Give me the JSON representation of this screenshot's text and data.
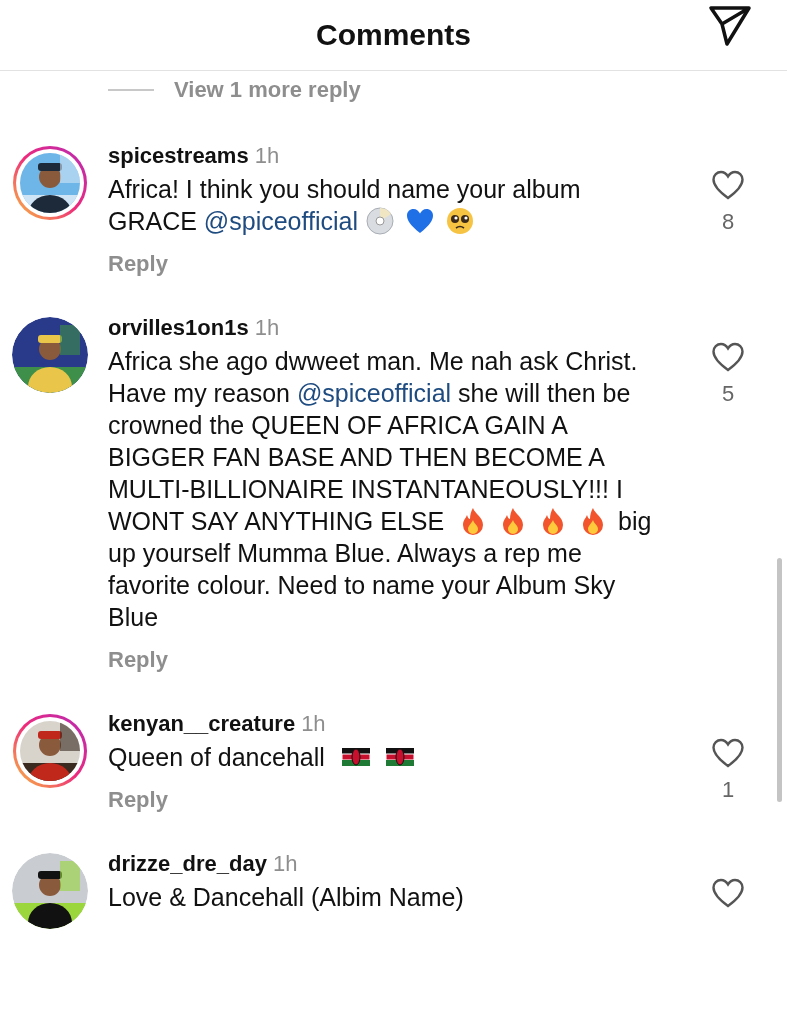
{
  "header": {
    "title": "Comments"
  },
  "view_more": "View 1 more reply",
  "comments": [
    {
      "username": "spicestreams",
      "time": "1h",
      "story_ring": true,
      "likes": "8",
      "reply": "Reply",
      "body": [
        {
          "kind": "text",
          "text": "Africa! I think you should name your album GRACE "
        },
        {
          "kind": "mention",
          "text": "@spiceofficial"
        },
        {
          "kind": "cd"
        },
        {
          "kind": "blue-heart"
        },
        {
          "kind": "pleading"
        }
      ]
    },
    {
      "username": "orvilles1on1s",
      "time": "1h",
      "story_ring": false,
      "likes": "5",
      "reply": "Reply",
      "body": [
        {
          "kind": "text",
          "text": "Africa she ago dwweet man. Me nah ask Christ. Have my reason "
        },
        {
          "kind": "mention",
          "text": "@spiceofficial"
        },
        {
          "kind": "text",
          "text": " she will then be crowned the QUEEN OF AFRICA GAIN A BIGGER FAN BASE AND THEN BECOME A MULTI-BILLIONAIRE INSTANTANEOUSLY!!! I WONT SAY ANYTHING ELSE "
        },
        {
          "kind": "fire"
        },
        {
          "kind": "fire"
        },
        {
          "kind": "fire"
        },
        {
          "kind": "fire"
        },
        {
          "kind": "text",
          "text": " big up yourself Mumma Blue. Always a rep me favorite colour. Need to name your Album Sky Blue"
        }
      ]
    },
    {
      "username": "kenyan__creature",
      "time": "1h",
      "story_ring": true,
      "likes": "1",
      "reply": "Reply",
      "body": [
        {
          "kind": "text",
          "text": "Queen of  dancehall "
        },
        {
          "kind": "kenya-flag"
        },
        {
          "kind": "kenya-flag"
        }
      ]
    },
    {
      "username": "drizze_dre_day",
      "time": "1h",
      "story_ring": false,
      "body": [
        {
          "kind": "text",
          "text": "Love & Dancehall (Albim Name)"
        }
      ]
    }
  ]
}
